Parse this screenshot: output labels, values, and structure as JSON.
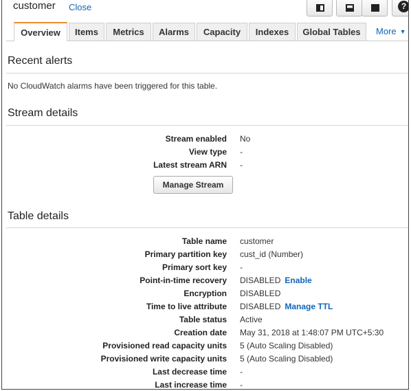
{
  "header": {
    "title": "customer",
    "close_label": "Close",
    "view_buttons": [
      "panel-left-icon",
      "panel-bottom-icon",
      "panel-full-icon"
    ],
    "help_glyph": "?"
  },
  "tabs": [
    {
      "label": "Overview",
      "active": true
    },
    {
      "label": "Items",
      "active": false
    },
    {
      "label": "Metrics",
      "active": false
    },
    {
      "label": "Alarms",
      "active": false
    },
    {
      "label": "Capacity",
      "active": false
    },
    {
      "label": "Indexes",
      "active": false
    },
    {
      "label": "Global Tables",
      "active": false
    }
  ],
  "more_label": "More",
  "recent_alerts": {
    "title": "Recent alerts",
    "message": "No CloudWatch alarms have been triggered for this table."
  },
  "stream_details": {
    "title": "Stream details",
    "rows": [
      {
        "label": "Stream enabled",
        "value": "No"
      },
      {
        "label": "View type",
        "value": "-"
      },
      {
        "label": "Latest stream ARN",
        "value": "-"
      }
    ],
    "manage_button": "Manage Stream"
  },
  "table_details": {
    "title": "Table details",
    "rows": [
      {
        "label": "Table name",
        "value": "customer"
      },
      {
        "label": "Primary partition key",
        "value": "cust_id (Number)"
      },
      {
        "label": "Primary sort key",
        "value": "-"
      },
      {
        "label": "Point-in-time recovery",
        "value": "DISABLED",
        "link": "Enable"
      },
      {
        "label": "Encryption",
        "value": "DISABLED"
      },
      {
        "label": "Time to live attribute",
        "value": "DISABLED",
        "link": "Manage TTL"
      },
      {
        "label": "Table status",
        "value": "Active"
      },
      {
        "label": "Creation date",
        "value": "May 31, 2018 at 1:48:07 PM UTC+5:30"
      },
      {
        "label": "Provisioned read capacity units",
        "value": "5 (Auto Scaling Disabled)"
      },
      {
        "label": "Provisioned write capacity units",
        "value": "5 (Auto Scaling Disabled)"
      },
      {
        "label": "Last decrease time",
        "value": "-"
      },
      {
        "label": "Last increase time",
        "value": "-"
      }
    ]
  },
  "colors": {
    "link": "#1166bb",
    "active_tab_accent": "#ee8a2b"
  }
}
